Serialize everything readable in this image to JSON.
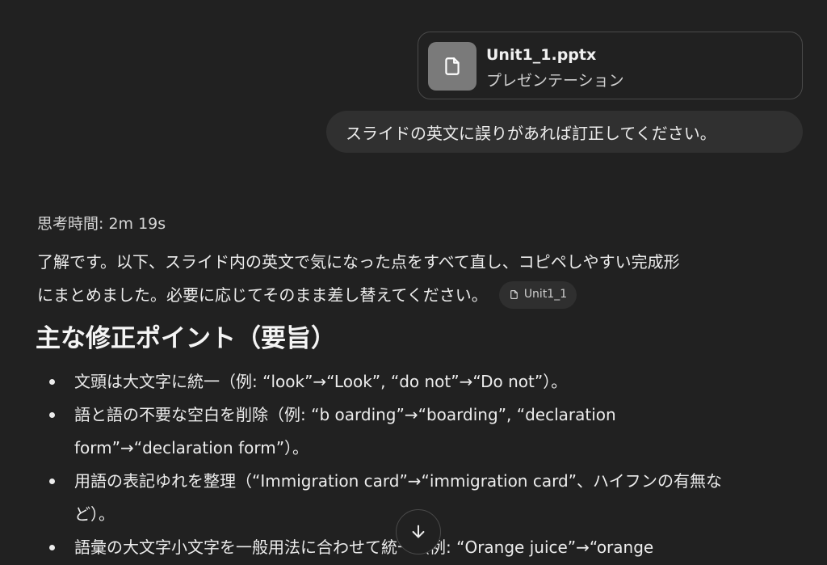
{
  "attachment": {
    "file_name": "Unit1_1.pptx",
    "file_type": "プレゼンテーション",
    "icon": "document-icon"
  },
  "user_message": "スライドの英文に誤りがあれば訂正してください。",
  "assistant": {
    "thinking_time": "思考時間: 2m 19s",
    "intro_line1": "了解です。以下、スライド内の英文で気になった点をすべて直し、コピペしやすい完成形",
    "intro_line2": "にまとめました。必要に応じてそのまま差し替えてください。",
    "source_chip": {
      "label": "Unit1_1",
      "icon": "document-icon"
    },
    "heading": "主な修正ポイント（要旨）",
    "bullets": [
      {
        "line1": "文頭は大文字に統一（例: “look”→“Look”, “do not”→“Do not”）。"
      },
      {
        "line1": "語と語の不要な空白を削除（例: “b oarding”→“boarding”, “declaration",
        "line2": "form”→“declaration form”）。"
      },
      {
        "line1": "用語の表記ゆれを整理（“Immigration card”→“immigration card”、ハイフンの有無な",
        "line2": "ど）。"
      },
      {
        "line1": "語彙の大文字小文字を一般用法に合わせて統一（例: “Orange juice”→“orange"
      }
    ]
  },
  "scroll_button": {
    "icon": "arrow-down-icon"
  }
}
